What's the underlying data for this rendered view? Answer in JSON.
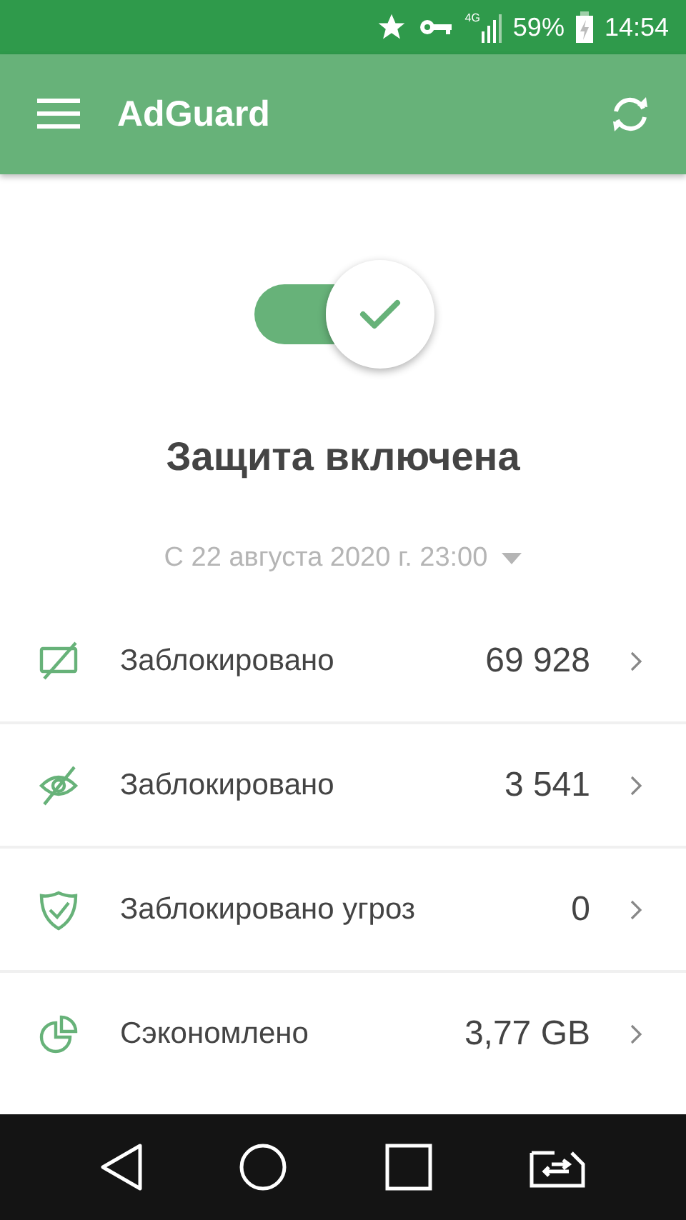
{
  "status_bar": {
    "network": "4G",
    "battery": "59%",
    "time": "14:54"
  },
  "app_bar": {
    "title": "AdGuard"
  },
  "protection": {
    "on": true,
    "status": "Защита включена",
    "period": "С 22 августа 2020 г. 23:00"
  },
  "stats": [
    {
      "kind": "ads",
      "label": "Заблокировано",
      "value": "69 928"
    },
    {
      "kind": "trackers",
      "label": "Заблокировано",
      "value": "3 541"
    },
    {
      "kind": "threats",
      "label": "Заблокировано угроз",
      "value": "0"
    },
    {
      "kind": "traffic",
      "label": "Сэкономлено",
      "value": "3,77 GB"
    }
  ]
}
